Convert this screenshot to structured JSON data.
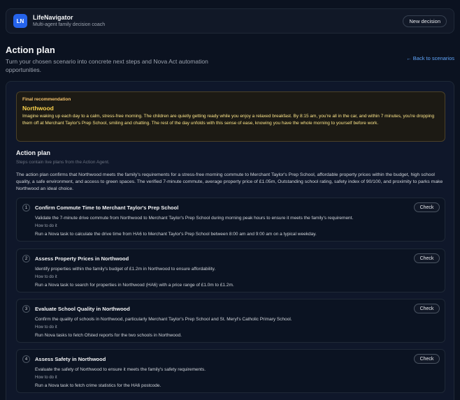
{
  "header": {
    "logo": "LN",
    "title": "LifeNavigator",
    "subtitle": "Multi-agent family decision coach",
    "new_decision_label": "New decision"
  },
  "page": {
    "title": "Action plan",
    "subtitle": "Turn your chosen scenario into concrete next steps and Nova Act automation opportunities.",
    "back_link": "← Back to scenarios"
  },
  "recommendation": {
    "label": "Final recommendation",
    "title": "Northwood",
    "text": "Imagine waking up each day to a calm, stress-free morning. The children are quietly getting ready while you enjoy a relaxed breakfast. By 8:15 am, you're all in the car, and within 7 minutes, you're dropping them off at Merchant Taylor's Prep School, smiling and chatting. The rest of the day unfolds with this sense of ease, knowing you have the whole morning to yourself before work."
  },
  "action_plan": {
    "heading": "Action plan",
    "subheading": "Steps contain live plans from the Action Agent.",
    "summary": "The action plan confirms that Northwood meets the family's requirements for a stress-free morning commute to Merchant Taylor's Prep School, affordable property prices within the budget, high school quality, a safe environment, and access to green spaces. The verified 7-minute commute, average property price of £1.05m, Outstanding school rating, safety index of 90/100, and proximity to parks make Northwood an ideal choice.",
    "how_label": "How to do it",
    "check_label": "Check",
    "steps": [
      {
        "num": "1",
        "title": "Confirm Commute Time to Merchant Taylor's Prep School",
        "desc": "Validate the 7-minute drive commute from Northwood to Merchant Taylor's Prep School during morning peak hours to ensure it meets the family's requirement.",
        "task": "Run a Nova task to calculate the drive time from HA6 to Merchant Taylor's Prep School between 8:00 am and 9:00 am on a typical weekday."
      },
      {
        "num": "2",
        "title": "Assess Property Prices in Northwood",
        "desc": "Identify properties within the family's budget of £1.2m in Northwood to ensure affordability.",
        "task": "Run a Nova task to search for properties in Northwood (HA6) with a price range of £1.0m to £1.2m."
      },
      {
        "num": "3",
        "title": "Evaluate School Quality in Northwood",
        "desc": "Confirm the quality of schools in Northwood, particularly Merchant Taylor's Prep School and St. Meryl's Catholic Primary School.",
        "task": "Run Nova tasks to fetch Ofsted reports for the two schools in Northwood."
      },
      {
        "num": "4",
        "title": "Assess Safety in Northwood",
        "desc": "Evaluate the safety of Northwood to ensure it meets the family's safety requirements.",
        "task": "Run a Nova task to fetch crime statistics for the HA6 postcode."
      }
    ]
  }
}
